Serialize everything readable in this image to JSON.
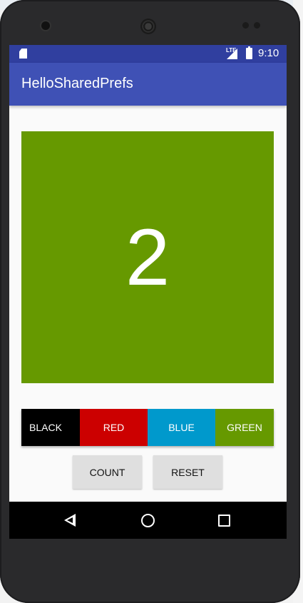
{
  "status_bar": {
    "time": "9:10",
    "network": "LTE"
  },
  "app_bar": {
    "title": "HelloSharedPrefs"
  },
  "counter": {
    "value": "2",
    "background_color": "#669900"
  },
  "color_buttons": [
    {
      "label": "BLACK",
      "color": "#000000"
    },
    {
      "label": "RED",
      "color": "#cc0000"
    },
    {
      "label": "BLUE",
      "color": "#0099cc"
    },
    {
      "label": "GREEN",
      "color": "#669900"
    }
  ],
  "actions": {
    "count_label": "COUNT",
    "reset_label": "RESET"
  },
  "nav": {
    "back_icon": "back-triangle",
    "home_icon": "home-circle",
    "recents_icon": "recents-square"
  }
}
